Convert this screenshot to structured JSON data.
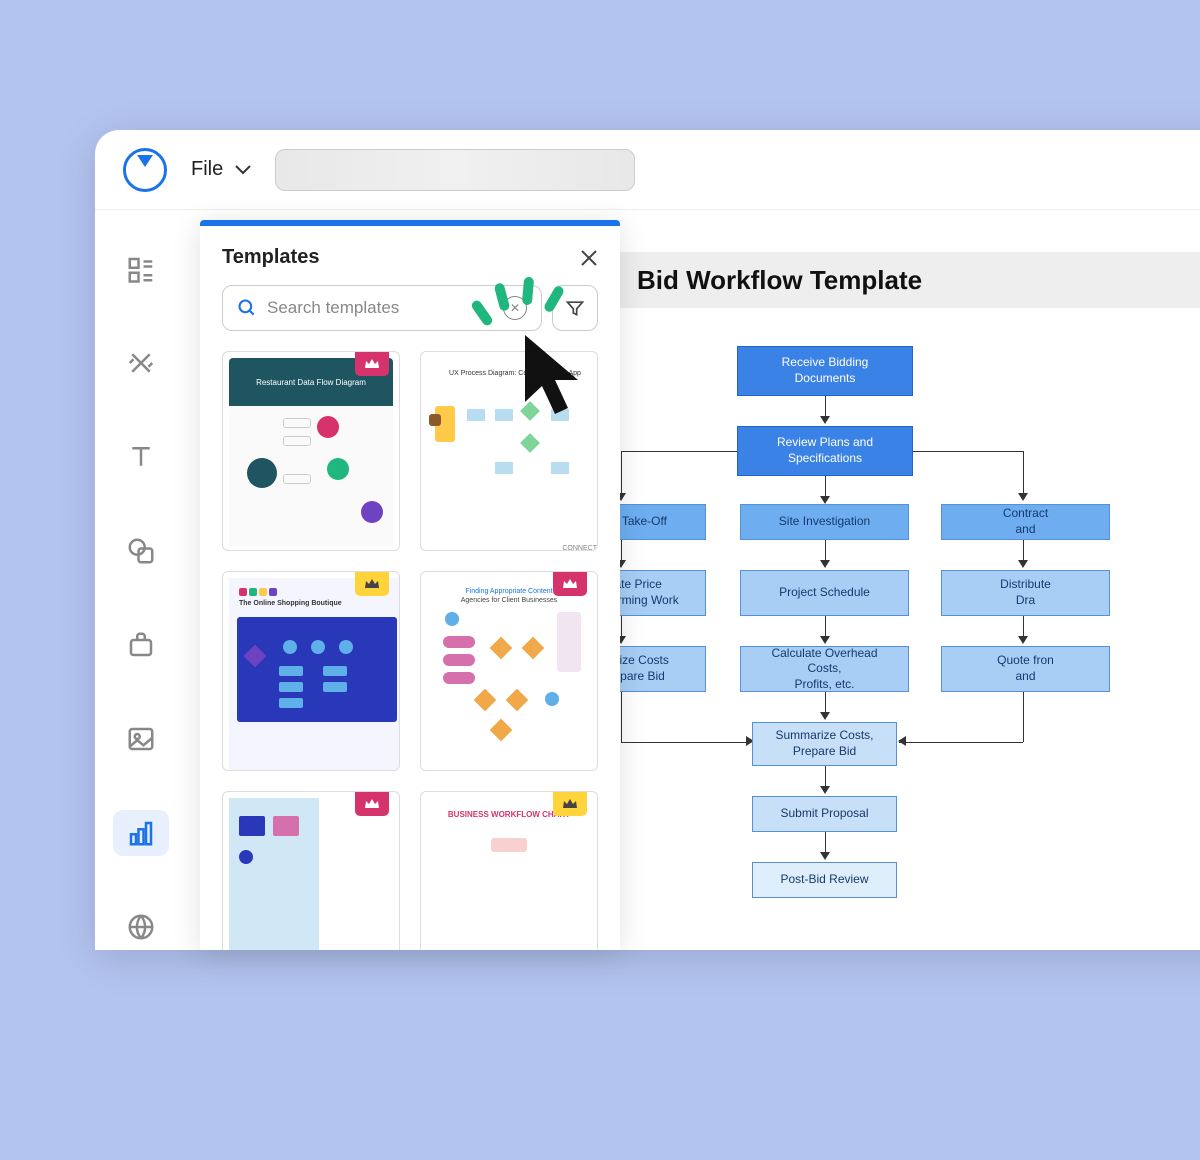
{
  "menu": {
    "file": "File"
  },
  "panel": {
    "title": "Templates",
    "search_placeholder": "Search templates"
  },
  "templates": {
    "t1": {
      "title": "Restaurant Data Flow Diagram",
      "badge": "pink"
    },
    "t2": {
      "title": "UX Process Diagram: Connect Mobile App",
      "badge": null
    },
    "t3": {
      "title": "The Online Shopping Boutique",
      "badge": "yellow"
    },
    "t4": {
      "title_a": "Finding Appropriate Content",
      "title_b": "Agencies for Client Businesses",
      "badge": "pink"
    },
    "t5": {
      "badge": "pink"
    },
    "t6": {
      "title": "BUSINESS WORKFLOW CHART",
      "badge": "yellow"
    }
  },
  "canvas": {
    "title": "Bid Workflow Template",
    "nodes": {
      "n1": "Receive Bidding Documents",
      "n2": "Review Plans and Specifications",
      "n3": "Material Take-Off",
      "n4": "Site Investigation",
      "n5a": "Contract",
      "n5b": "and",
      "n6a": "Calculate Price",
      "n6b": "Self-Performing Work",
      "n7": "Project Schedule",
      "n8a": "Distribute",
      "n8b": "Dra",
      "n9a": "Summarize Costs",
      "n9b": "and Prepare Bid",
      "n10a": "Calculate Overhead Costs,",
      "n10b": "Profits, etc.",
      "n11a": "Quote fron",
      "n11b": "and",
      "n12a": "Summarize Costs,",
      "n12b": "Prepare Bid",
      "n13": "Submit Proposal",
      "n14": "Post-Bid Review"
    }
  }
}
